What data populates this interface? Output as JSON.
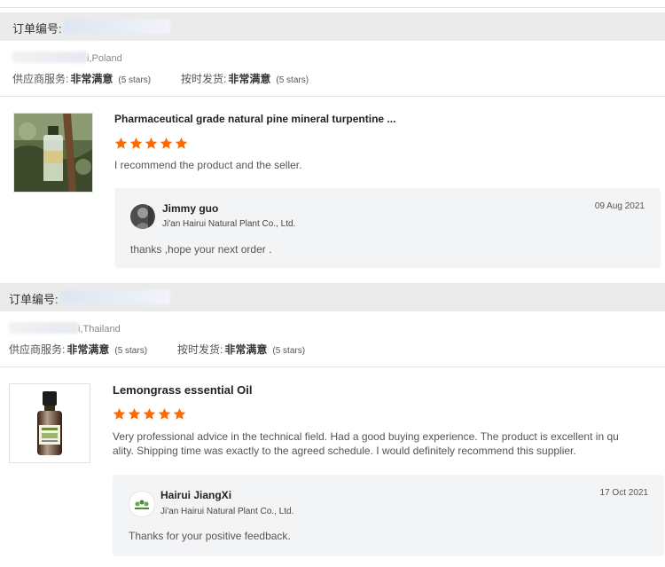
{
  "accent_color": "#ff6a00",
  "reviews": [
    {
      "order_label": "订单编号:",
      "buyer_location": "i,Poland",
      "supplier_service_label": "供应商服务:",
      "supplier_service_value": "非常满意",
      "supplier_service_stars": "(5 stars)",
      "ontime_label": "按时发货:",
      "ontime_value": "非常满意",
      "ontime_stars": "(5 stars)",
      "product_title": "Pharmaceutical grade natural pine mineral turpentine ...",
      "rating": 5,
      "comment": "I recommend the product and the seller.",
      "reply": {
        "name": "Jimmy guo",
        "company": "Ji'an Hairui Natural Plant Co., Ltd.",
        "date": "09 Aug 2021",
        "text": "thanks ,hope your next order ."
      }
    },
    {
      "order_label": "订单编号:",
      "buyer_location": "i,Thailand",
      "supplier_service_label": "供应商服务:",
      "supplier_service_value": "非常满意",
      "supplier_service_stars": "(5 stars)",
      "ontime_label": "按时发货:",
      "ontime_value": "非常满意",
      "ontime_stars": "(5 stars)",
      "product_title": "Lemongrass essential Oil",
      "rating": 5,
      "comment_line1": "Very professional advice in the technical field. Had a good buying experience. The product is excellent in qu",
      "comment_line2": "ality. Shipping time was exactly to the agreed schedule. I would definitely recommend this supplier.",
      "reply": {
        "name": "Hairui JiangXi",
        "company": "Ji'an Hairui Natural Plant Co., Ltd.",
        "date": "17 Oct 2021",
        "text": "Thanks for your positive feedback."
      }
    }
  ]
}
